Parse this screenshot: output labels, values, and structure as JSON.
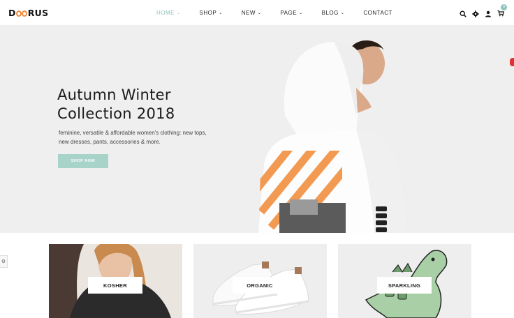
{
  "brand": {
    "logo_text_prefix": "D",
    "logo_text_suffix": "RUS"
  },
  "nav": {
    "items": [
      {
        "label": "HOME",
        "active": true
      },
      {
        "label": "SHOP",
        "active": false
      },
      {
        "label": "NEW",
        "active": false
      },
      {
        "label": "PAGE",
        "active": false
      },
      {
        "label": "BLOG",
        "active": false
      },
      {
        "label": "CONTACT",
        "active": false
      }
    ]
  },
  "header_icons": {
    "search": "search-icon",
    "settings": "gear-icon",
    "account": "user-icon",
    "cart": "cart-icon",
    "cart_count": "0"
  },
  "hero": {
    "title": "Autumn Winter\nCollection 2018",
    "subtitle": "feminine, versatile & affordable women's clothing: new tops, new dresses, pants, accessories & more.",
    "cta_label": "SHOP NOW"
  },
  "categories": [
    {
      "label": "KOSHER"
    },
    {
      "label": "ORGANIC"
    },
    {
      "label": "SPARKLING"
    }
  ],
  "colors": {
    "accent": "#8ec5bd",
    "button": "#a8d3c9",
    "hero_bg": "#efefef",
    "logo_ring": "#f08a3a"
  }
}
